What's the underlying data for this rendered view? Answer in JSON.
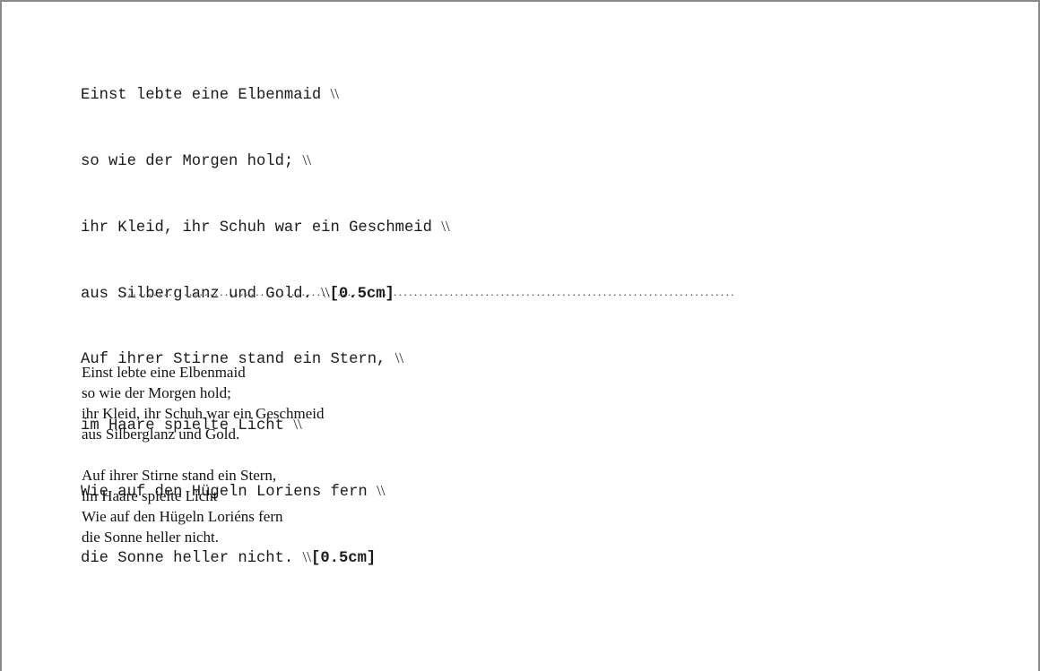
{
  "source": {
    "lines": [
      {
        "text": "Einst lebte eine Elbenmaid ",
        "sep": "\\\\",
        "opt": ""
      },
      {
        "text": "so wie der Morgen hold; ",
        "sep": "\\\\",
        "opt": ""
      },
      {
        "text": "ihr Kleid, ihr Schuh war ein Geschmeid ",
        "sep": "\\\\",
        "opt": ""
      },
      {
        "text": "aus Silberglanz und Gold. ",
        "sep": "\\\\",
        "opt": "[0.5cm]"
      },
      {
        "text": "Auf ihrer Stirne stand ein Stern, ",
        "sep": "\\\\",
        "opt": ""
      },
      {
        "text": "im Haare spielte Licht ",
        "sep": "\\\\",
        "opt": ""
      },
      {
        "text": "Wie auf den Hügeln Loriens fern ",
        "sep": "\\\\",
        "opt": ""
      },
      {
        "text": "die Sonne heller nicht. ",
        "sep": "\\\\",
        "opt": "[0.5cm]"
      }
    ]
  },
  "divider": {
    "dots": "........................................................................................................................"
  },
  "rendered": {
    "stanzas": [
      {
        "lines": [
          "Einst lebte eine Elbenmaid",
          "so wie der Morgen hold;",
          "ihr Kleid, ihr Schuh war ein Geschmeid",
          "aus Silberglanz und Gold."
        ]
      },
      {
        "lines": [
          "Auf ihrer Stirne stand ein Stern,",
          "im Haare spielte Licht",
          "Wie auf den Hügeln Loriéns fern",
          "die Sonne heller nicht."
        ]
      }
    ]
  }
}
